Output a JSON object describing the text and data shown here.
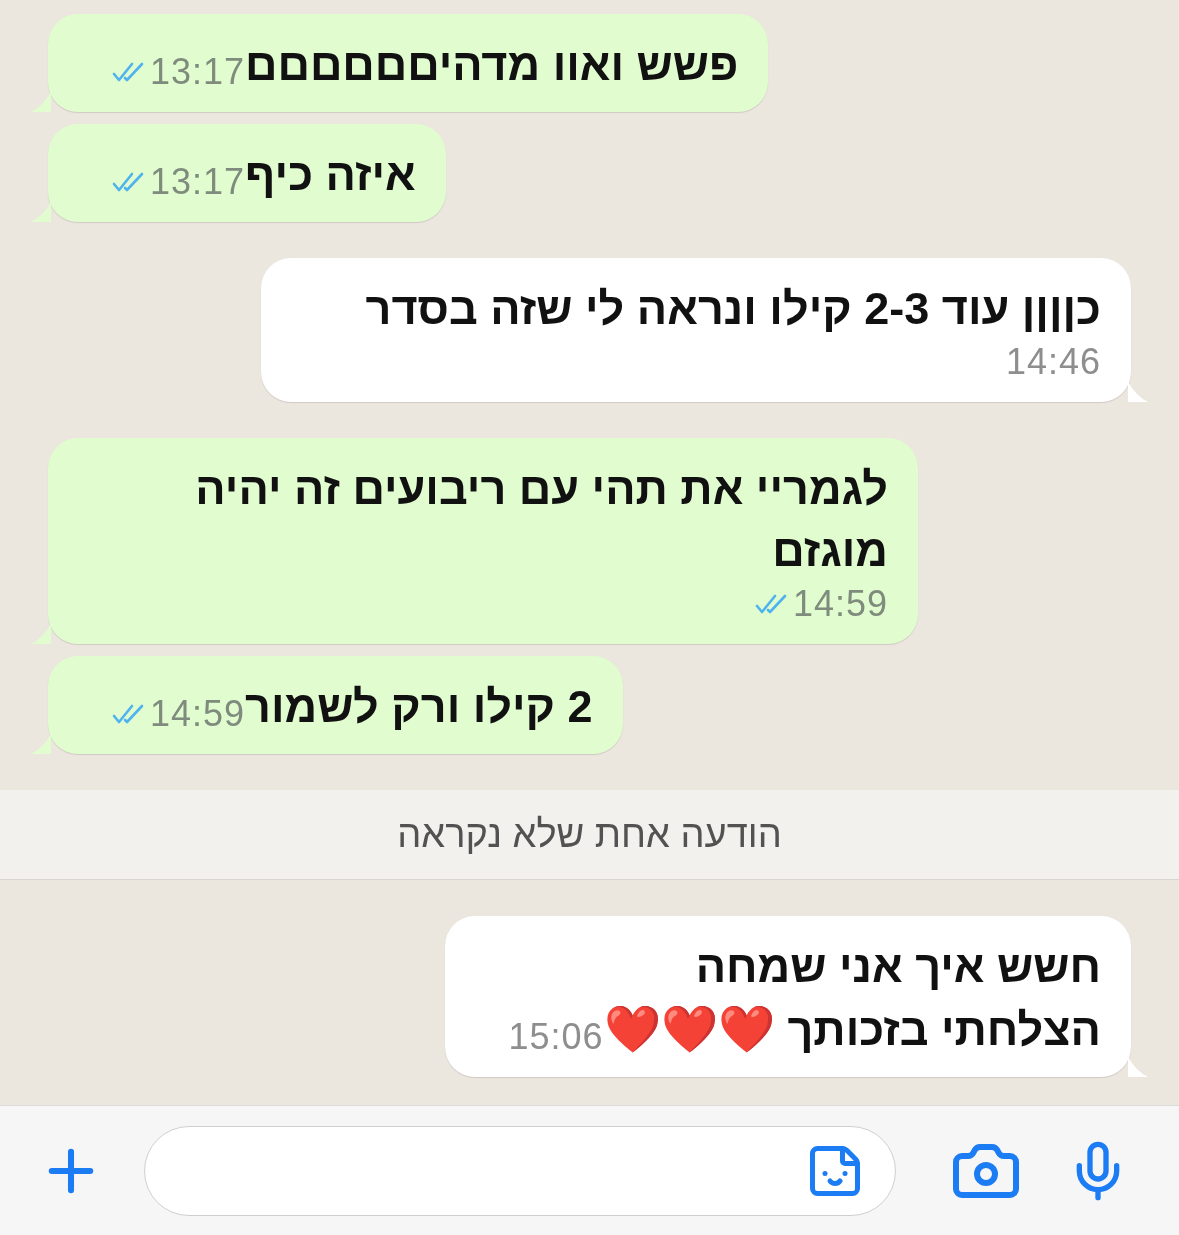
{
  "messages": [
    {
      "kind": "sent",
      "lines": [
        "פשש ואוו מדהיםםםםםם"
      ],
      "time": "13:17",
      "read": true
    },
    {
      "kind": "sent",
      "lines": [
        "איזה כיף"
      ],
      "time": "13:17",
      "read": true
    },
    {
      "kind": "received",
      "lines": [
        "כןןןן עוד 2-3 קילו ונראה לי שזה בסדר"
      ],
      "time": "14:46"
    },
    {
      "kind": "sent",
      "lines": [
        "לגמריי את תהי עם ריבועים זה יהיה",
        "מוגזם"
      ],
      "time": "14:59",
      "read": true
    },
    {
      "kind": "sent",
      "lines": [
        "2 קילו ורק לשמור"
      ],
      "time": "14:59",
      "read": true
    },
    {
      "kind": "banner",
      "text": "הודעה אחת שלא נקראה"
    },
    {
      "kind": "received",
      "lines": [
        "חשש איך אני שמחה",
        "הצלחתי בזכותך"
      ],
      "emoji": "❤️❤️❤️",
      "time": "15:06"
    }
  ]
}
